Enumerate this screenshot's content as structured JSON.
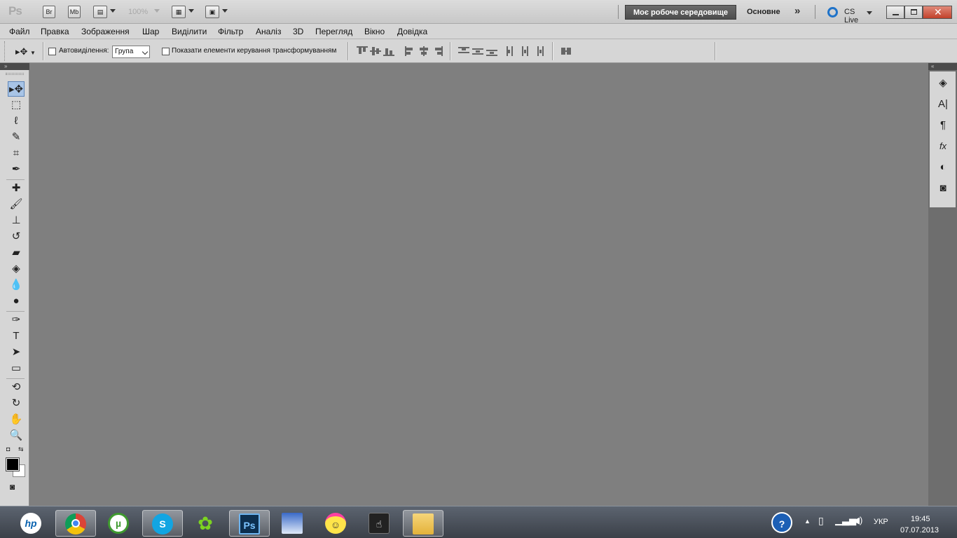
{
  "appbar": {
    "logo": "Ps",
    "bridge_label": "Br",
    "minibridge_label": "Mb",
    "zoom": "100%",
    "workspace_active": "Моє робоче середовище",
    "workspace_basic": "Основне",
    "more": "»",
    "cslive": "CS Live"
  },
  "menu": [
    "Файл",
    "Правка",
    "Зображення",
    "Шар",
    "Виділити",
    "Фільтр",
    "Аналіз",
    "3D",
    "Перегляд",
    "Вікно",
    "Довідка"
  ],
  "options": {
    "auto_select_label": "Автовиділення:",
    "auto_select_value": "Група",
    "show_transform_label": "Показати елементи керування трансформуванням"
  },
  "tools": [
    {
      "name": "move-tool-icon",
      "glyph": "▸✥"
    },
    {
      "name": "marquee-tool-icon",
      "glyph": "⬚"
    },
    {
      "name": "lasso-tool-icon",
      "glyph": "ℓ"
    },
    {
      "name": "quick-selection-tool-icon",
      "glyph": "✎"
    },
    {
      "name": "crop-tool-icon",
      "glyph": "⌗"
    },
    {
      "name": "eyedropper-tool-icon",
      "glyph": "✒"
    },
    {
      "name": "healing-brush-tool-icon",
      "glyph": "✚"
    },
    {
      "name": "brush-tool-icon",
      "glyph": "🖌"
    },
    {
      "name": "clone-stamp-tool-icon",
      "glyph": "⊥"
    },
    {
      "name": "history-brush-tool-icon",
      "glyph": "↺"
    },
    {
      "name": "eraser-tool-icon",
      "glyph": "▰"
    },
    {
      "name": "paint-bucket-tool-icon",
      "glyph": "◈"
    },
    {
      "name": "blur-tool-icon",
      "glyph": "💧"
    },
    {
      "name": "dodge-tool-icon",
      "glyph": "●"
    },
    {
      "name": "pen-tool-icon",
      "glyph": "✑"
    },
    {
      "name": "type-tool-icon",
      "glyph": "T"
    },
    {
      "name": "path-selection-tool-icon",
      "glyph": "➤"
    },
    {
      "name": "rectangle-tool-icon",
      "glyph": "▭"
    },
    {
      "name": "3d-rotate-tool-icon",
      "glyph": "⟲"
    },
    {
      "name": "3d-orbit-tool-icon",
      "glyph": "↻"
    },
    {
      "name": "hand-tool-icon",
      "glyph": "✋"
    },
    {
      "name": "zoom-tool-icon",
      "glyph": "🔍"
    }
  ],
  "right_panel": [
    {
      "name": "layers-panel-icon",
      "glyph": "◈"
    },
    {
      "name": "character-panel-icon",
      "glyph": "A|"
    },
    {
      "name": "paragraph-panel-icon",
      "glyph": "¶"
    },
    {
      "name": "styles-panel-icon",
      "glyph": "fx"
    },
    {
      "name": "adjustments-panel-icon",
      "glyph": "◐"
    },
    {
      "name": "masks-panel-icon",
      "glyph": "◙"
    }
  ],
  "taskbar": {
    "apps": [
      "hp-icon",
      "chrome-icon",
      "utorrent-icon",
      "skype-icon",
      "icq-icon",
      "photoshop-icon",
      "photo-editor-icon",
      "smiley-icon",
      "touch-app-icon",
      "file-explorer-icon"
    ],
    "language": "УКР",
    "time": "19:45",
    "date": "07.07.2013"
  }
}
